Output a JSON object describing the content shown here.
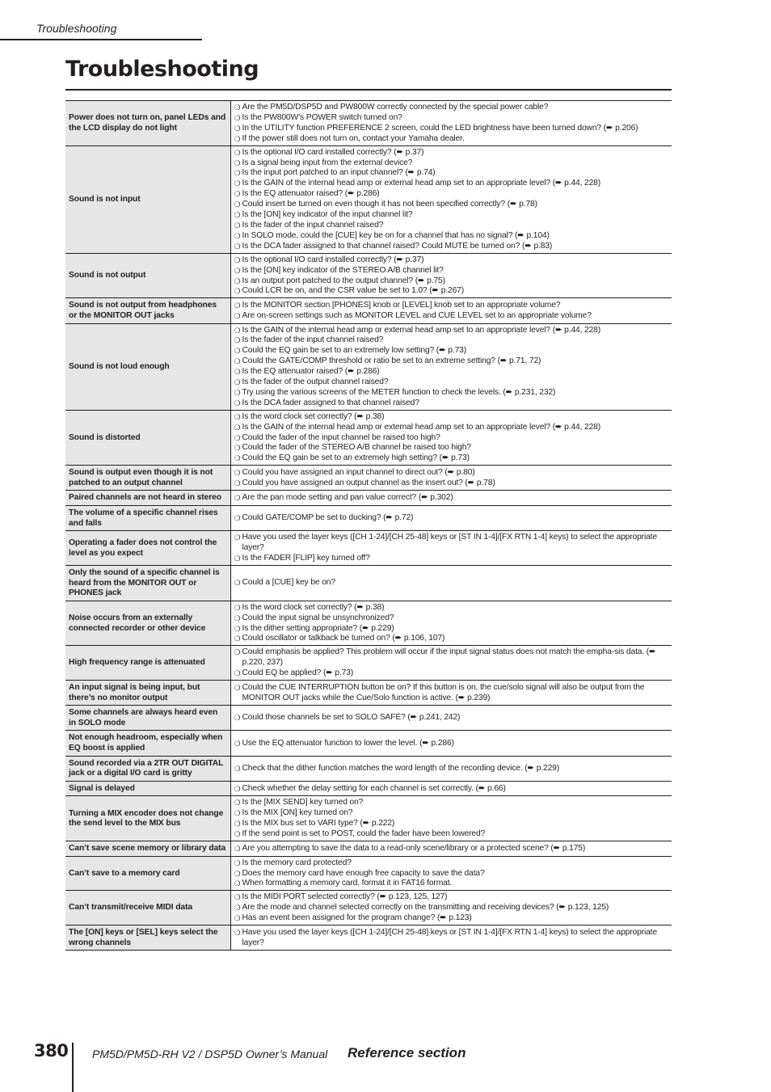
{
  "running_head": "Troubleshooting",
  "page_title": "Troubleshooting",
  "ref_arrow": "➨",
  "bullet": "❍",
  "rows": [
    {
      "problem": "Power does not turn on, panel LEDs and the LCD display do not light",
      "checks": [
        "Are the PM5D/DSP5D and PW800W correctly connected by the special power cable?",
        "Is the PW800W’s POWER switch turned on?",
        "In the UTILITY function PREFERENCE 2 screen, could the LED brightness have been turned down? (➨ p.206)",
        "If the power still does not turn on, contact your Yamaha dealer."
      ]
    },
    {
      "problem": "Sound is not input",
      "checks": [
        "Is the optional I/O card installed correctly? (➨ p.37)",
        "Is a signal being input from the external device?",
        "Is the input port patched to an input channel? (➨ p.74)",
        "Is the GAIN of the internal head amp or external head amp set to an appropriate level? (➨ p.44, 228)",
        "Is the EQ attenuator raised? (➨ p.286)",
        "Could insert be turned on even though it has not been specified correctly? (➨ p.78)",
        "Is the [ON] key indicator of the input channel lit?",
        "Is the fader of the input channel raised?",
        "In SOLO mode, could the [CUE] key be on for a channel that has no signal? (➨ p.104)",
        "Is the DCA fader assigned to that channel raised? Could MUTE be turned on? (➨ p.83)"
      ]
    },
    {
      "problem": "Sound is not output",
      "checks": [
        "Is the optional I/O card installed correctly? (➨ p.37)",
        "Is the [ON] key indicator of the STEREO A/B channel lit?",
        "Is an output port patched to the output channel? (➨ p.75)",
        "Could LCR be on, and the CSR value be set to 1.0? (➨ p.267)"
      ]
    },
    {
      "problem": "Sound is not output from headphones or the MONITOR OUT jacks",
      "checks": [
        "Is the MONITOR section [PHONES] knob or [LEVEL] knob set to an appropriate volume?",
        "Are on-screen settings such as MONITOR LEVEL and CUE LEVEL set to an appropriate volume?"
      ]
    },
    {
      "problem": "Sound is not loud enough",
      "checks": [
        "Is the GAIN of the internal head amp or external head amp set to an appropriate level? (➨ p.44, 228)",
        "Is the fader of the input channel raised?",
        "Could the EQ gain be set to an extremely low setting? (➨ p.73)",
        "Could the GATE/COMP threshold or ratio be set to an extreme setting? (➨ p.71, 72)",
        "Is the EQ attenuator raised? (➨ p.286)",
        "Is the fader of the output channel raised?",
        "Try using the various screens of the METER function to check the levels. (➨ p.231, 232)",
        "Is the DCA fader assigned to that channel raised?"
      ]
    },
    {
      "problem": "Sound is distorted",
      "checks": [
        "Is the word clock set correctly? (➨ p.38)",
        "Is the GAIN of the internal head amp or external head amp set to an appropriate level? (➨ p.44, 228)",
        "Could the fader of the input channel be raised too high?",
        "Could the fader of the STEREO A/B channel be raised too high?",
        "Could the EQ gain be set to an extremely high setting? (➨ p.73)"
      ]
    },
    {
      "problem": "Sound is output even though it is not patched to an output channel",
      "checks": [
        "Could you have assigned an input channel to direct out? (➨ p.80)",
        "Could you have assigned an output channel as the insert out? (➨ p.78)"
      ]
    },
    {
      "problem": "Paired channels are not heard in stereo",
      "checks": [
        "Are the pan mode setting and pan value correct? (➨ p.302)"
      ]
    },
    {
      "problem": "The volume of a specific channel rises and falls",
      "checks": [
        "Could GATE/COMP be set to ducking? (➨ p.72)"
      ]
    },
    {
      "problem": "Operating a fader does not control the level as you expect",
      "checks": [
        "Have you used the layer keys ([CH 1-24]/[CH 25-48] keys or [ST IN 1-4]/[FX RTN 1-4] keys) to select the appropriate layer?",
        "Is the FADER [FLIP] key turned off?"
      ]
    },
    {
      "problem": "Only the sound of a specific channel is heard from the MONITOR OUT or PHONES jack",
      "checks": [
        "Could a [CUE] key be on?"
      ]
    },
    {
      "problem": "Noise occurs from an externally connected recorder or other device",
      "checks": [
        "Is the word clock set correctly? (➨ p.38)",
        "Could the input signal be unsynchronized?",
        "Is the dither setting appropriate? (➨ p.229)",
        "Could oscillator or talkback be turned on? (➨ p.106, 107)"
      ]
    },
    {
      "problem": "High frequency range is attenuated",
      "checks": [
        "Could emphasis be applied? This problem will occur if the input signal status does not match the empha-sis data. (➨ p.220, 237)",
        "Could EQ be applied? (➨ p.73)"
      ]
    },
    {
      "problem": "An input signal is being input, but there’s no monitor output",
      "checks": [
        "Could the CUE INTERRUPTION button be on? If this button is on, the cue/solo signal will also be output from the MONITOR OUT jacks while the Cue/Solo function is active. (➨ p.239)"
      ]
    },
    {
      "problem": "Some channels are always heard even in SOLO mode",
      "checks": [
        "Could those channels be set to SOLO SAFE? (➨ p.241, 242)"
      ]
    },
    {
      "problem": "Not enough headroom, especially when EQ boost is applied",
      "checks": [
        "Use the EQ attenuator function to lower the level. (➨ p.286)"
      ]
    },
    {
      "problem": "Sound recorded via a 2TR OUT DIGITAL jack or a digital I/O card is gritty",
      "checks": [
        "Check that the dither function matches the word length of the recording device. (➨ p.229)"
      ]
    },
    {
      "problem": "Signal is delayed",
      "checks": [
        "Check whether the delay setting for each channel is set correctly. (➨ p.66)"
      ]
    },
    {
      "problem": "Turning a MIX encoder does not change the send level to the MIX bus",
      "checks": [
        "Is the [MIX SEND] key turned on?",
        "Is the MIX [ON] key turned on?",
        "Is the MIX bus set to VARI type? (➨ p.222)",
        "If the send point is set to POST, could the fader have been lowered?"
      ]
    },
    {
      "problem": "Can’t save scene memory or library data",
      "checks": [
        "Are you attempting to save the data to a read-only scene/library or a protected scene? (➨ p.175)"
      ]
    },
    {
      "problem": "Can’t save to a memory card",
      "checks": [
        "Is the memory card protected?",
        "Does the memory card have enough free capacity to save the data?",
        "When formatting a memory card, format it in FAT16 format."
      ]
    },
    {
      "problem": "Can’t transmit/receive MIDI data",
      "checks": [
        "Is the MIDI PORT selected correctly? (➨ p.123, 125, 127)",
        "Are the mode and channel selected correctly on the transmitting and receiving devices? (➨ p.123, 125)",
        "Has an event been assigned for the program change? (➨ p.123)"
      ]
    },
    {
      "problem": "The [ON] keys or [SEL] keys select the wrong channels",
      "checks": [
        "Have you used the layer keys ([CH 1-24]/[CH 25-48] keys or [ST IN 1-4]/[FX RTN 1-4] keys) to select the appropriate layer?"
      ]
    }
  ],
  "footer": {
    "page_number": "380",
    "manual_title": "PM5D/PM5D-RH V2 / DSP5D Owner’s Manual",
    "section": "Reference section"
  }
}
